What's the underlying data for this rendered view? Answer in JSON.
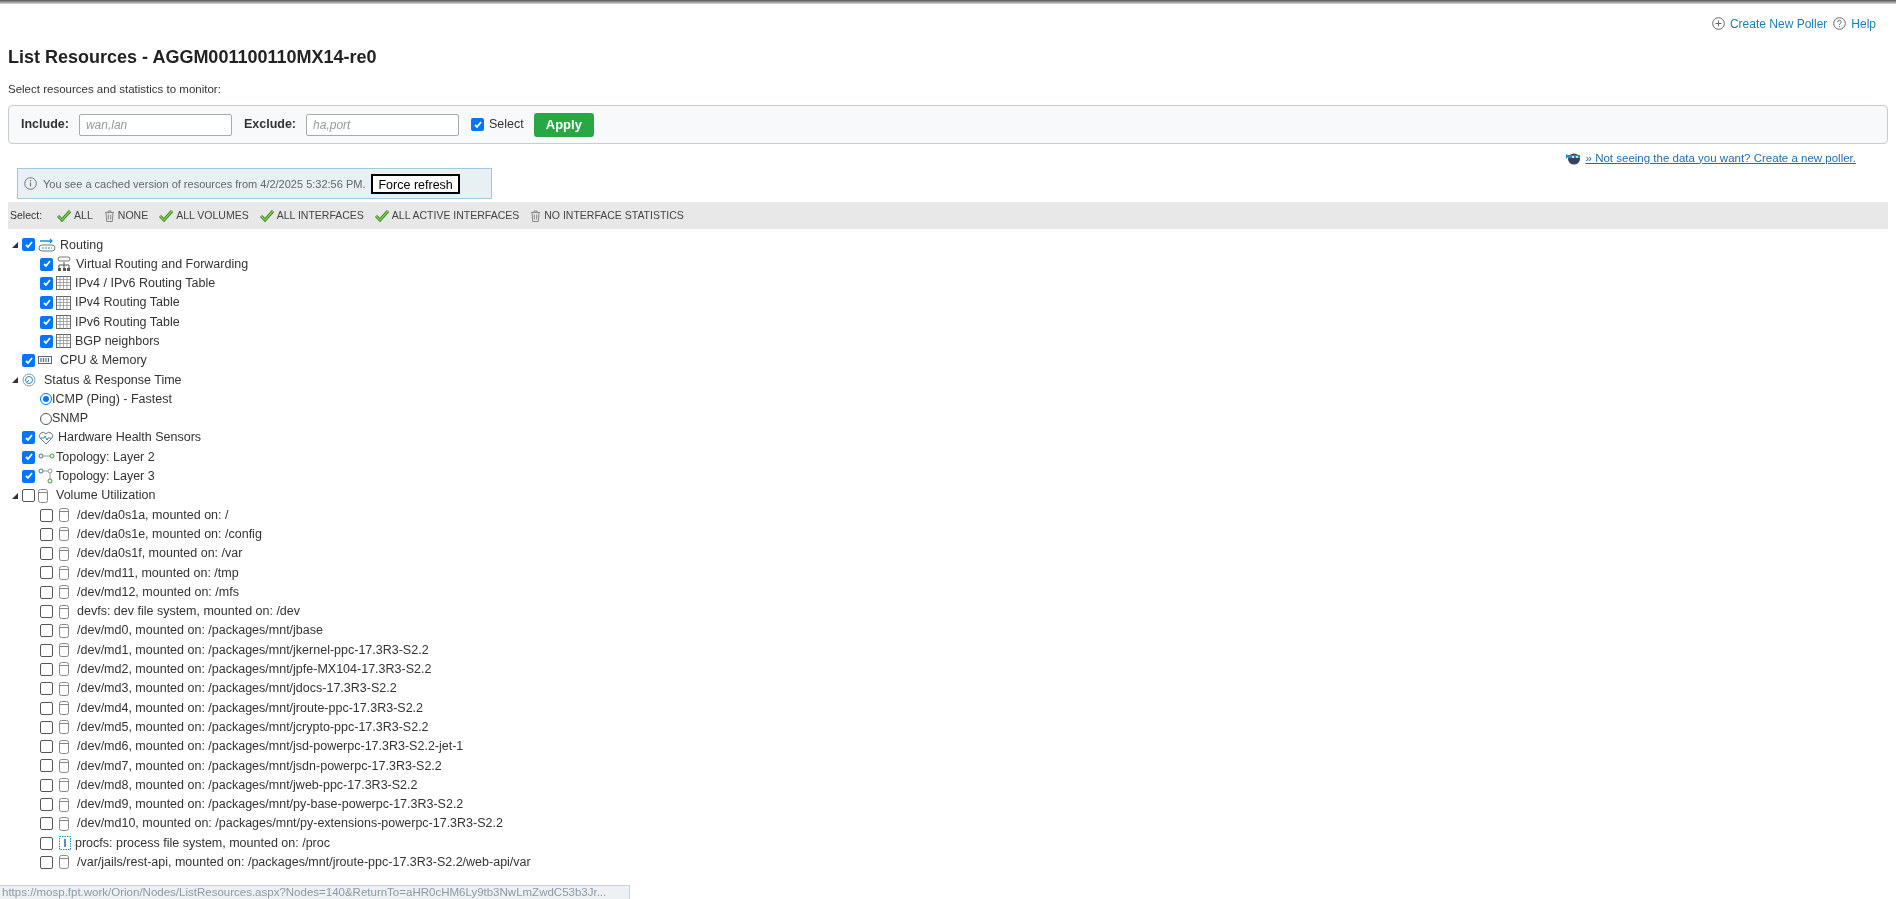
{
  "top_links": [
    {
      "kind": "add",
      "label": "Create New Poller"
    },
    {
      "kind": "help",
      "label": "Help"
    }
  ],
  "title": "List Resources - AGGM001100110MX14-re0",
  "subtitle": "Select resources and statistics to monitor:",
  "filter": {
    "include_label": "Include:",
    "include_placeholder": "wan,lan",
    "exclude_label": "Exclude:",
    "exclude_placeholder": "ha,port",
    "select_label": "Select",
    "select_checked": true,
    "apply": "Apply"
  },
  "poller_link": "» Not seeing the data you want? Create a new poller.",
  "cache_notice": {
    "text": "You see a cached version of resources from 4/2/2025 5:32:56 PM.",
    "button": "Force refresh"
  },
  "select_bar": {
    "label": "Select:",
    "actions": [
      {
        "kind": "check",
        "label": "ALL"
      },
      {
        "kind": "clear",
        "label": "NONE"
      },
      {
        "kind": "check",
        "label": "ALL VOLUMES"
      },
      {
        "kind": "check",
        "label": "ALL INTERFACES"
      },
      {
        "kind": "check",
        "label": "ALL ACTIVE INTERFACES"
      },
      {
        "kind": "clear",
        "label": "NO INTERFACE STATISTICS"
      }
    ]
  },
  "tree": [
    {
      "kind": "checkbox",
      "label": "Routing",
      "checked": true,
      "expanded": true,
      "children": [
        {
          "kind": "checkbox",
          "label": "Virtual Routing and Forwarding",
          "checked": true
        },
        {
          "kind": "checkbox",
          "label": "IPv4 / IPv6 Routing Table",
          "checked": true
        },
        {
          "kind": "checkbox",
          "label": "IPv4 Routing Table",
          "checked": true
        },
        {
          "kind": "checkbox",
          "label": "IPv6 Routing Table",
          "checked": true
        },
        {
          "kind": "checkbox",
          "label": "BGP neighbors",
          "checked": true
        }
      ]
    },
    {
      "kind": "checkbox",
      "label": "CPU & Memory",
      "checked": true
    },
    {
      "kind": "group",
      "label": "Status & Response Time",
      "expanded": true,
      "children": [
        {
          "kind": "radio",
          "label": "ICMP (Ping) - Fastest",
          "selected": true
        },
        {
          "kind": "radio",
          "label": "SNMP",
          "selected": false
        }
      ]
    },
    {
      "kind": "checkbox",
      "label": "Hardware Health Sensors",
      "checked": true
    },
    {
      "kind": "checkbox",
      "label": "Topology: Layer 2",
      "checked": true
    },
    {
      "kind": "checkbox",
      "label": "Topology: Layer 3",
      "checked": true
    },
    {
      "kind": "checkbox",
      "label": "Volume Utilization",
      "checked": false,
      "expanded": true,
      "children": [
        {
          "kind": "checkbox",
          "label": "/dev/da0s1a, mounted on: /",
          "checked": false
        },
        {
          "kind": "checkbox",
          "label": "/dev/da0s1e, mounted on: /config",
          "checked": false
        },
        {
          "kind": "checkbox",
          "label": "/dev/da0s1f, mounted on: /var",
          "checked": false
        },
        {
          "kind": "checkbox",
          "label": "/dev/md11, mounted on: /tmp",
          "checked": false
        },
        {
          "kind": "checkbox",
          "label": "/dev/md12, mounted on: /mfs",
          "checked": false
        },
        {
          "kind": "checkbox",
          "label": "devfs: dev file system, mounted on: /dev",
          "checked": false
        },
        {
          "kind": "checkbox",
          "label": "/dev/md0, mounted on: /packages/mnt/jbase",
          "checked": false
        },
        {
          "kind": "checkbox",
          "label": "/dev/md1, mounted on: /packages/mnt/jkernel-ppc-17.3R3-S2.2",
          "checked": false
        },
        {
          "kind": "checkbox",
          "label": "/dev/md2, mounted on: /packages/mnt/jpfe-MX104-17.3R3-S2.2",
          "checked": false
        },
        {
          "kind": "checkbox",
          "label": "/dev/md3, mounted on: /packages/mnt/jdocs-17.3R3-S2.2",
          "checked": false
        },
        {
          "kind": "checkbox",
          "label": "/dev/md4, mounted on: /packages/mnt/jroute-ppc-17.3R3-S2.2",
          "checked": false
        },
        {
          "kind": "checkbox",
          "label": "/dev/md5, mounted on: /packages/mnt/jcrypto-ppc-17.3R3-S2.2",
          "checked": false
        },
        {
          "kind": "checkbox",
          "label": "/dev/md6, mounted on: /packages/mnt/jsd-powerpc-17.3R3-S2.2-jet-1",
          "checked": false
        },
        {
          "kind": "checkbox",
          "label": "/dev/md7, mounted on: /packages/mnt/jsdn-powerpc-17.3R3-S2.2",
          "checked": false
        },
        {
          "kind": "checkbox",
          "label": "/dev/md8, mounted on: /packages/mnt/jweb-ppc-17.3R3-S2.2",
          "checked": false
        },
        {
          "kind": "checkbox",
          "label": "/dev/md9, mounted on: /packages/mnt/py-base-powerpc-17.3R3-S2.2",
          "checked": false
        },
        {
          "kind": "checkbox",
          "label": "/dev/md10, mounted on: /packages/mnt/py-extensions-powerpc-17.3R3-S2.2",
          "checked": false
        },
        {
          "kind": "checkbox",
          "label": "procfs: process file system, mounted on: /proc",
          "checked": false
        },
        {
          "kind": "checkbox",
          "label": "/var/jails/rest-api, mounted on: /packages/mnt/jroute-ppc-17.3R3-S2.2/web-api/var",
          "checked": false
        }
      ]
    }
  ],
  "status_bar": {
    "url": "https://mosp.fpt.work/Orion/Nodes/ListResources.aspx?Nodes=140&ReturnTo=aHR0cHM6Ly9tb3NwLmZwdC53b3Jr..."
  }
}
